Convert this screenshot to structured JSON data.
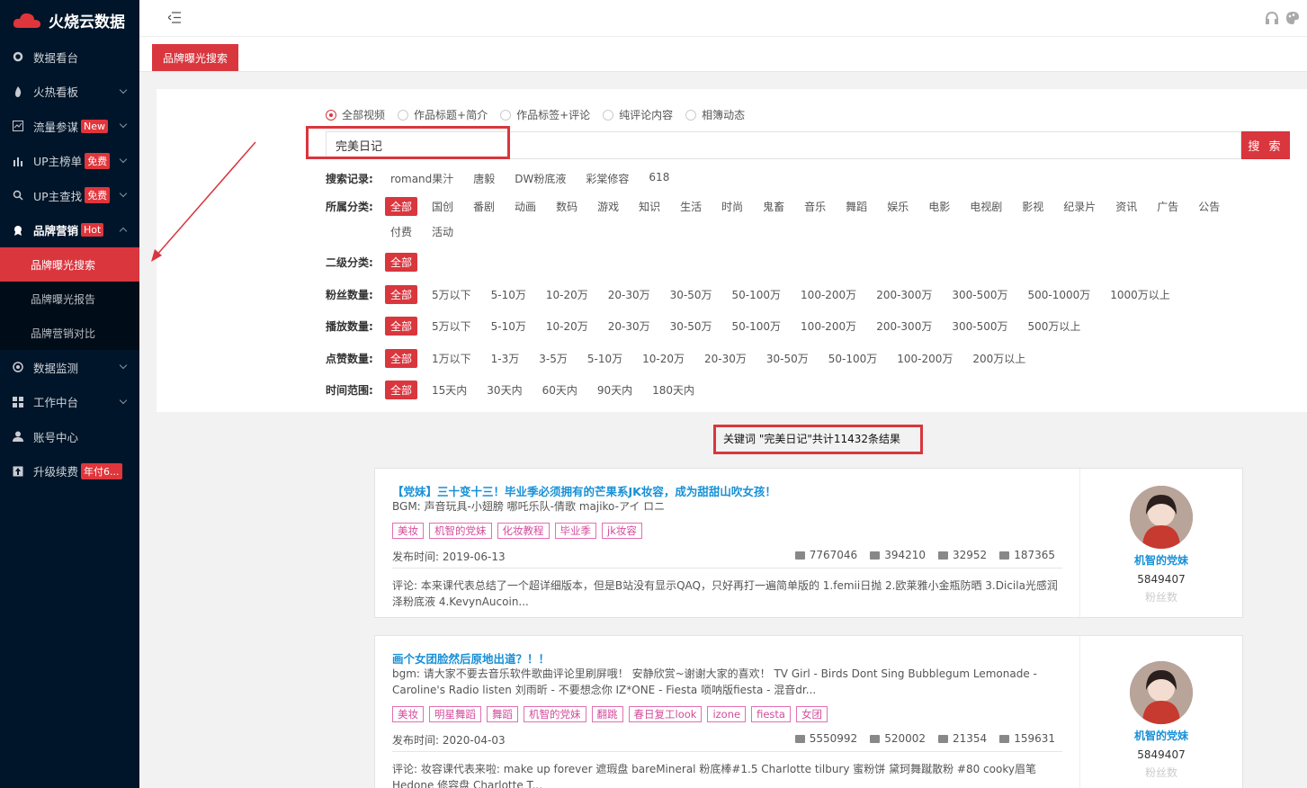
{
  "app": {
    "title": "火烧云数据"
  },
  "sidebar": {
    "items": [
      {
        "label": "数据看台"
      },
      {
        "label": "火热看板"
      },
      {
        "label": "流量参谋",
        "badge": "New"
      },
      {
        "label": "UP主榜单",
        "badge": "免费"
      },
      {
        "label": "UP主查找",
        "badge": "免费"
      },
      {
        "label": "品牌营销",
        "badge": "Hot"
      },
      {
        "label": "数据监测"
      },
      {
        "label": "工作中台"
      },
      {
        "label": "账号中心"
      },
      {
        "label": "升级续费",
        "badge": "年付6..."
      }
    ],
    "sub_items": [
      {
        "label": "品牌曝光搜索"
      },
      {
        "label": "品牌曝光报告"
      },
      {
        "label": "品牌营销对比"
      }
    ]
  },
  "tabs": {
    "active": "品牌曝光搜索"
  },
  "search": {
    "scopes": [
      "全部视频",
      "作品标题+简介",
      "作品标签+评论",
      "纯评论内容",
      "相簿动态"
    ],
    "value": "完美日记",
    "button": "搜 索"
  },
  "filters": {
    "history": {
      "label": "搜索记录:",
      "options": [
        "romand果汁",
        "唐毅",
        "DW粉底液",
        "彩棠修容",
        "618"
      ]
    },
    "category": {
      "label": "所属分类:",
      "options": [
        "全部",
        "国创",
        "番剧",
        "动画",
        "数码",
        "游戏",
        "知识",
        "生活",
        "时尚",
        "鬼畜",
        "音乐",
        "舞蹈",
        "娱乐",
        "电影",
        "电视剧",
        "影视",
        "纪录片",
        "资讯",
        "广告",
        "公告",
        "付费",
        "活动"
      ]
    },
    "subcategory": {
      "label": "二级分类:",
      "options": [
        "全部"
      ]
    },
    "fans": {
      "label": "粉丝数量:",
      "options": [
        "全部",
        "5万以下",
        "5-10万",
        "10-20万",
        "20-30万",
        "30-50万",
        "50-100万",
        "100-200万",
        "200-300万",
        "300-500万",
        "500-1000万",
        "1000万以上"
      ]
    },
    "plays": {
      "label": "播放数量:",
      "options": [
        "全部",
        "5万以下",
        "5-10万",
        "10-20万",
        "20-30万",
        "30-50万",
        "50-100万",
        "100-200万",
        "200-300万",
        "300-500万",
        "500万以上"
      ]
    },
    "likes": {
      "label": "点赞数量:",
      "options": [
        "全部",
        "1万以下",
        "1-3万",
        "3-5万",
        "5-10万",
        "10-20万",
        "20-30万",
        "30-50万",
        "50-100万",
        "100-200万",
        "200万以上"
      ]
    },
    "time": {
      "label": "时间范围:",
      "options": [
        "全部",
        "15天内",
        "30天内",
        "60天内",
        "90天内",
        "180天内"
      ]
    }
  },
  "result_note": "关键词 \"完美日记\"共计11432条结果",
  "results": [
    {
      "title": "【党妹】三十变十三！毕业季必须拥有的芒果系JK妆容，成为甜甜山吹女孩！",
      "bgm": "BGM:  声音玩具-小翅膀 哪吒乐队-倩歌 majiko-アイ ロニ",
      "tags": [
        "美妆",
        "机智的党妹",
        "化妆教程",
        "毕业季",
        "jk妆容"
      ],
      "date": "发布时间:  2019-06-13",
      "stats": [
        "7767046",
        "394210",
        "32952",
        "187365"
      ],
      "comment": "评论:  本来课代表总结了一个超详细版本，但是B站没有显示QAQ，只好再打一遍简单版的 1.femii日抛 2.欧莱雅小金瓶防晒 3.Dicila光感润泽粉底液 4.KevynAucoin...",
      "author": "机智的党妹",
      "fans": "5849407",
      "fans_label": "粉丝数"
    },
    {
      "title": "画个女团脸然后原地出道？！！",
      "bgm": "bgm:  请大家不要去音乐软件歌曲评论里刷屏哦！ 安静欣赏~谢谢大家的喜欢！  TV Girl - Birds Dont Sing Bubblegum Lemonade - Caroline's Radio listen 刘雨昕 - 不要想念你 IZ*ONE - Fiesta 唢呐版fiesta - 混音dr...",
      "tags": [
        "美妆",
        "明星舞蹈",
        "舞蹈",
        "机智的党妹",
        "翻跳",
        "春日复工look",
        "izone",
        "fiesta",
        "女团"
      ],
      "date": "发布时间:  2020-04-03",
      "stats": [
        "5550992",
        "520002",
        "21354",
        "159631"
      ],
      "comment": "评论:  妆容课代表来啦:  make up forever 遮瑕盘 bareMineral 粉底棒#1.5 Charlotte tilbury 蜜粉饼 黛珂舞蹴散粉 #80 cooky眉笔 Hedone 修容盘 Charlotte T...",
      "author": "机智的党妹",
      "fans": "5849407",
      "fans_label": "粉丝数"
    }
  ],
  "colors": {
    "accent": "#d9363e",
    "sidebar": "#001529",
    "link": "#1890d6",
    "tag": "#d44b9b"
  }
}
